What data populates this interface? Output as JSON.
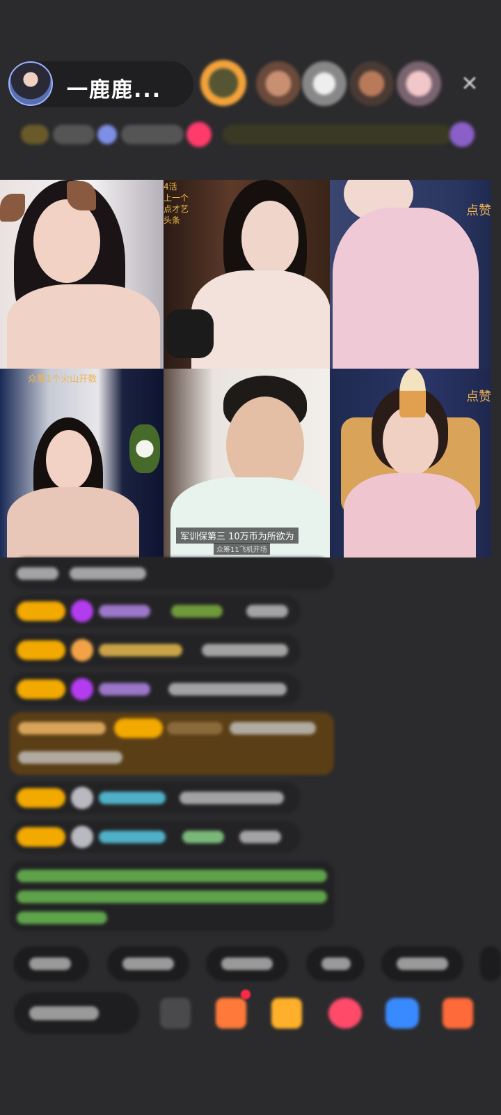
{
  "header": {
    "host_name": "一鹿鹿..."
  },
  "tiles": [
    {
      "label": ""
    },
    {
      "label": "",
      "side_text": [
        "4活",
        "上一个",
        "点才艺",
        "头条"
      ]
    },
    {
      "label": "点赞"
    },
    {
      "label": "众筹1个火山开数"
    },
    {
      "caption": "军训保第三 10万币为所欲为",
      "subcaption": "众筹11飞机开场"
    },
    {
      "label": "点赞"
    }
  ],
  "colors": {
    "background": "#2b2b2d",
    "badge": "#f2a900",
    "gold_message": "#5a3e16",
    "accent_pink": "#ff3b6b"
  },
  "icons": [
    "close-icon",
    "gift-icon",
    "game-icon",
    "heart-icon",
    "chat-icon",
    "shop-icon",
    "more-icon"
  ]
}
